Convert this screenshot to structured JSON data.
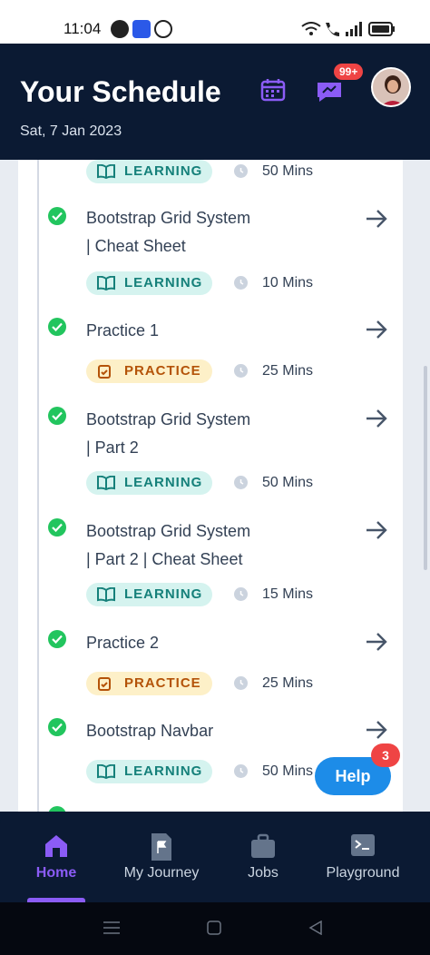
{
  "status_bar": {
    "time": "11:04"
  },
  "header": {
    "title": "Your Schedule",
    "date": "Sat, 7 Jan 2023",
    "messages_badge": "99+"
  },
  "schedule": {
    "items": [
      {
        "lines": [],
        "tag": "LEARNING",
        "duration": "50 Mins"
      },
      {
        "lines": [
          "Bootstrap Grid System",
          "| Cheat Sheet"
        ],
        "tag": "LEARNING",
        "duration": "10 Mins"
      },
      {
        "lines": [
          "Practice 1"
        ],
        "tag": "PRACTICE",
        "duration": "25 Mins"
      },
      {
        "lines": [
          "Bootstrap Grid System",
          "| Part 2"
        ],
        "tag": "LEARNING",
        "duration": "50 Mins"
      },
      {
        "lines": [
          "Bootstrap Grid System",
          "| Part 2 | Cheat Sheet"
        ],
        "tag": "LEARNING",
        "duration": "15 Mins"
      },
      {
        "lines": [
          "Practice 2"
        ],
        "tag": "PRACTICE",
        "duration": "25 Mins"
      },
      {
        "lines": [
          "Bootstrap Navbar"
        ],
        "tag": "LEARNING",
        "duration": "50 Mins"
      }
    ]
  },
  "help": {
    "label": "Help",
    "badge": "3"
  },
  "bottom_nav": {
    "items": [
      {
        "label": "Home",
        "icon": "home-icon",
        "active": true
      },
      {
        "label": "My Journey",
        "icon": "flag-icon",
        "active": false
      },
      {
        "label": "Jobs",
        "icon": "briefcase-icon",
        "active": false
      },
      {
        "label": "Playground",
        "icon": "terminal-icon",
        "active": false
      }
    ]
  },
  "colors": {
    "header_bg": "#0b1a33",
    "learning_bg": "#d5f3ef",
    "learning_text": "#15807a",
    "practice_bg": "#fdf0c8",
    "practice_text": "#b45309",
    "accent": "#8b5cf6",
    "check": "#22c55e",
    "help": "#1d8ce8",
    "badge": "#ef4444"
  }
}
